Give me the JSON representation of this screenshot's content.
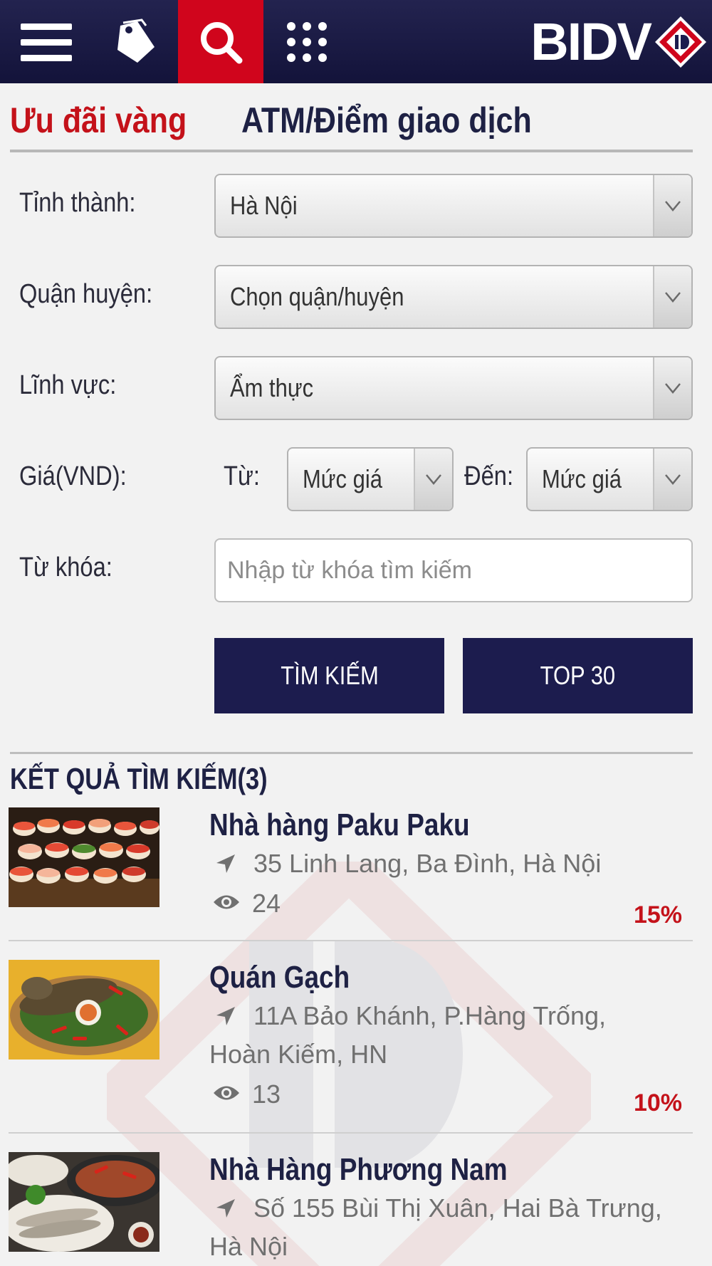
{
  "header": {
    "menu_icon": "hamburger-menu-icon",
    "tag_icon": "price-tag-icon",
    "search_icon": "search-icon",
    "apps_icon": "grid-apps-icon",
    "logo_text": "BIDV",
    "brand_color": "#1c1c4e",
    "accent_color": "#d0051c"
  },
  "tabs": [
    {
      "label": "Ưu đãi vàng",
      "active": true
    },
    {
      "label": "ATM/Điểm giao dịch",
      "active": false
    }
  ],
  "form": {
    "province": {
      "label": "Tỉnh thành:",
      "value": "Hà Nội"
    },
    "district": {
      "label": "Quận huyện:",
      "value": "Chọn quận/huyện"
    },
    "category": {
      "label": "Lĩnh vực:",
      "value": "Ẩm thực"
    },
    "price": {
      "label": "Giá(VND):",
      "from_label": "Từ:",
      "from_value": "Mức giá",
      "to_label": "Đến:",
      "to_value": "Mức giá"
    },
    "keyword": {
      "label": "Từ khóa:",
      "placeholder": "Nhập từ khóa tìm kiếm",
      "value": ""
    },
    "search_button": "TÌM KIẾM",
    "top_button": "TOP 30"
  },
  "results": {
    "title": "KẾT QUẢ TÌM KIẾM(3)",
    "items": [
      {
        "name": "Nhà hàng Paku Paku",
        "address": "35 Linh Lang, Ba Đình, Hà Nội",
        "views": "24",
        "discount": "15%",
        "image": "sushi-photo"
      },
      {
        "name": "Quán Gạch",
        "address": "11A Bảo Khánh, P.Hàng Trống, Hoàn Kiếm, HN",
        "views": "13",
        "discount": "10%",
        "image": "grilled-fish-photo"
      },
      {
        "name": "Nhà Hàng Phương Nam",
        "address": "Số 155 Bùi Thị Xuân, Hai Bà Trưng, Hà Nội",
        "views": "",
        "discount": "",
        "image": "fish-hotpot-photo"
      }
    ]
  }
}
